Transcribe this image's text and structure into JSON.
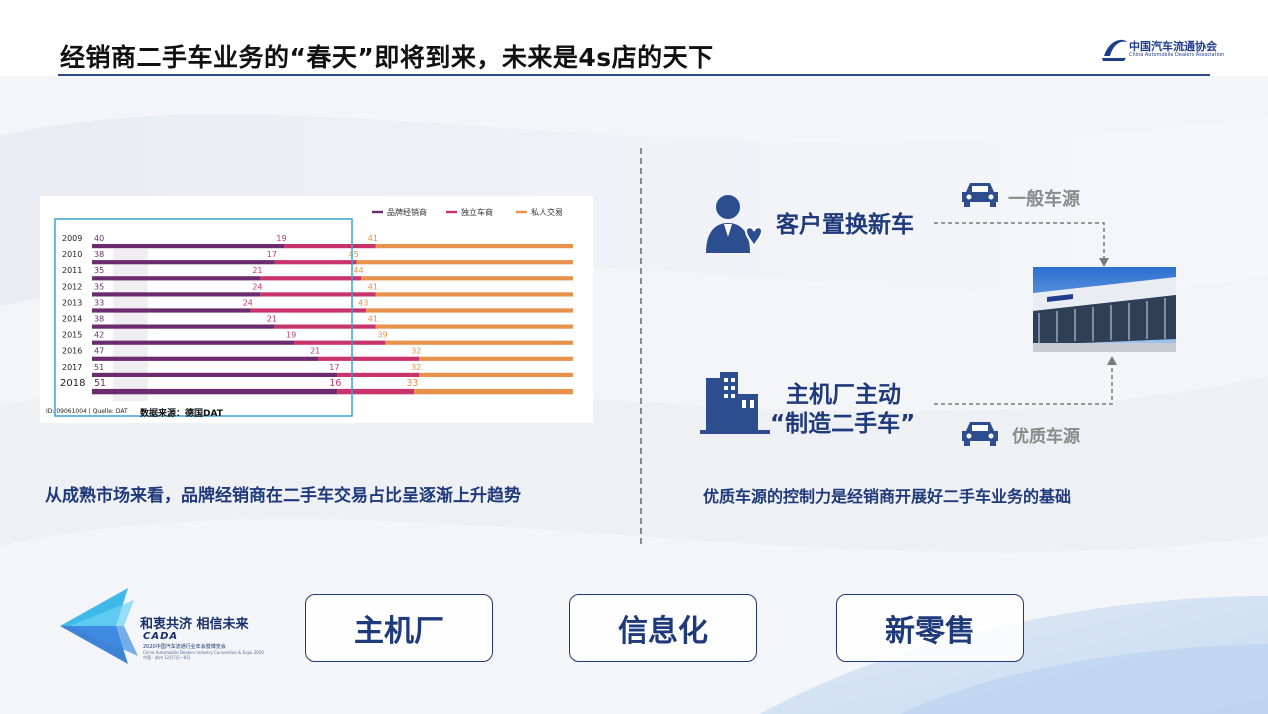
{
  "slide": {
    "title": "经销商二手车业务的“春天”即将到来，未来是4s店的天下"
  },
  "logo": {
    "cn": "中国汽车流通协会",
    "en": "China Automobile Dealers Association"
  },
  "left": {
    "caption": "从成熟市场来看，品牌经销商在二手车交易占比呈逐渐上升趋势",
    "chart_footer_id": "ID: 09061004 | Quelle: DAT",
    "chart_source": "数据来源：德国DAT"
  },
  "chart_data": {
    "type": "bar",
    "orientation": "horizontal",
    "stacked": true,
    "categories": [
      "2009",
      "2010",
      "2011",
      "2012",
      "2013",
      "2014",
      "2015",
      "2016",
      "2017",
      "2018"
    ],
    "series": [
      {
        "name": "品牌经销商",
        "color": "#6b2b6e",
        "values": [
          40,
          38,
          35,
          35,
          33,
          38,
          42,
          47,
          51,
          51
        ]
      },
      {
        "name": "独立车商",
        "color": "#c8336b",
        "values": [
          19,
          17,
          21,
          24,
          24,
          21,
          19,
          21,
          17,
          16
        ]
      },
      {
        "name": "私人交易",
        "color": "#e8914a",
        "values": [
          41,
          45,
          44,
          41,
          43,
          41,
          39,
          32,
          32,
          33
        ]
      }
    ],
    "xlim": [
      0,
      100
    ],
    "legend": "top-right",
    "highlight_last_category": true
  },
  "right": {
    "customer_label": "客户置换新车",
    "general_source": "一般车源",
    "oem_line1": "主机厂主动",
    "oem_line2": "“制造二手车”",
    "quality_source": "优质车源",
    "caption": "优质车源的控制力是经销商开展好二手车业务的基础"
  },
  "event": {
    "slogan": "和衷共济  相信未来",
    "cada": "CADA",
    "name": "2020中国汽车流通行业年会暨博览会",
    "sub1": "China Automobile Dealers Industry Convention & Expo 2020",
    "sub2": "中国 · 苏州  12月7日—8日"
  },
  "buttons": [
    "主机厂",
    "信息化",
    "新零售"
  ]
}
